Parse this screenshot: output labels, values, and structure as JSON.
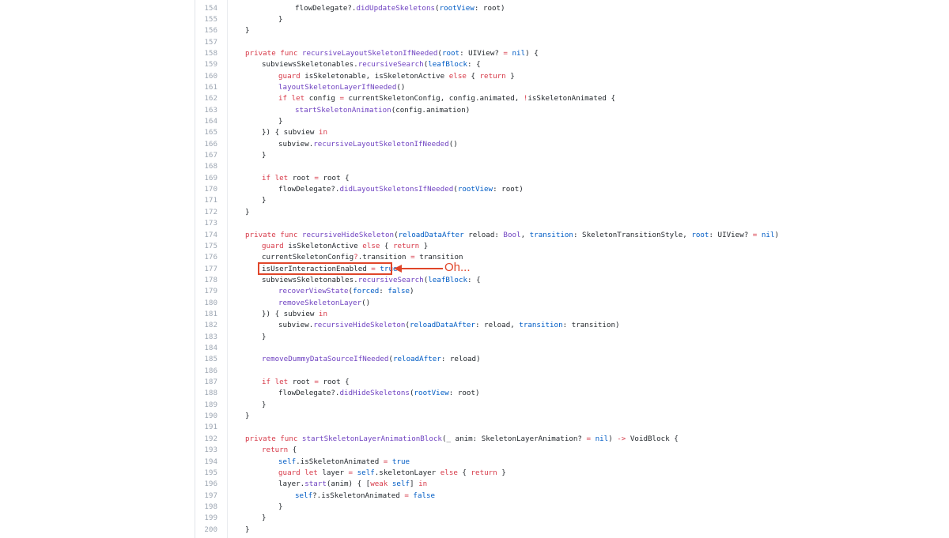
{
  "annotation": {
    "text": "Oh..."
  },
  "lines": [
    {
      "n": "154",
      "indent": 4,
      "tokens": [
        [
          "flowDelegate?.",
          ""
        ],
        [
          "didUpdateSkeletons",
          "f"
        ],
        [
          "(",
          ""
        ],
        [
          "rootView",
          "p"
        ],
        [
          ": root)",
          ""
        ]
      ]
    },
    {
      "n": "155",
      "indent": 3,
      "tokens": [
        [
          "}",
          ""
        ]
      ]
    },
    {
      "n": "156",
      "indent": 1,
      "tokens": [
        [
          "}",
          ""
        ]
      ]
    },
    {
      "n": "157",
      "indent": 0,
      "tokens": []
    },
    {
      "n": "158",
      "indent": 1,
      "tokens": [
        [
          "private func ",
          "k"
        ],
        [
          "recursiveLayoutSkeletonIfNeeded",
          "f"
        ],
        [
          "(",
          ""
        ],
        [
          "root",
          "p"
        ],
        [
          ": UIView? ",
          ""
        ],
        [
          "=",
          "k"
        ],
        [
          " ",
          ""
        ],
        [
          "nil",
          "p"
        ],
        [
          ") {",
          ""
        ]
      ]
    },
    {
      "n": "159",
      "indent": 2,
      "tokens": [
        [
          "subviewsSkeletonables.",
          ""
        ],
        [
          "recursiveSearch",
          "f"
        ],
        [
          "(",
          ""
        ],
        [
          "leafBlock",
          "p"
        ],
        [
          ": {",
          ""
        ]
      ]
    },
    {
      "n": "160",
      "indent": 3,
      "tokens": [
        [
          "guard",
          "k"
        ],
        [
          " isSkeletonable, isSkeletonActive ",
          ""
        ],
        [
          "else",
          "k"
        ],
        [
          " { ",
          ""
        ],
        [
          "return",
          "k"
        ],
        [
          " }",
          ""
        ]
      ]
    },
    {
      "n": "161",
      "indent": 3,
      "tokens": [
        [
          "layoutSkeletonLayerIfNeeded",
          "f"
        ],
        [
          "()",
          ""
        ]
      ]
    },
    {
      "n": "162",
      "indent": 3,
      "tokens": [
        [
          "if let",
          "k"
        ],
        [
          " config ",
          ""
        ],
        [
          "=",
          "k"
        ],
        [
          " currentSkeletonConfig, config.animated, ",
          ""
        ],
        [
          "!",
          "k"
        ],
        [
          "isSkeletonAnimated {",
          ""
        ]
      ]
    },
    {
      "n": "163",
      "indent": 4,
      "tokens": [
        [
          "startSkeletonAnimation",
          "f"
        ],
        [
          "(config.animation)",
          ""
        ]
      ]
    },
    {
      "n": "164",
      "indent": 3,
      "tokens": [
        [
          "}",
          ""
        ]
      ]
    },
    {
      "n": "165",
      "indent": 2,
      "tokens": [
        [
          "}) { subview ",
          ""
        ],
        [
          "in",
          "k"
        ]
      ]
    },
    {
      "n": "166",
      "indent": 3,
      "tokens": [
        [
          "subview.",
          ""
        ],
        [
          "recursiveLayoutSkeletonIfNeeded",
          "f"
        ],
        [
          "()",
          ""
        ]
      ]
    },
    {
      "n": "167",
      "indent": 2,
      "tokens": [
        [
          "}",
          ""
        ]
      ]
    },
    {
      "n": "168",
      "indent": 0,
      "tokens": []
    },
    {
      "n": "169",
      "indent": 2,
      "tokens": [
        [
          "if let",
          "k"
        ],
        [
          " root ",
          ""
        ],
        [
          "=",
          "k"
        ],
        [
          " root {",
          ""
        ]
      ]
    },
    {
      "n": "170",
      "indent": 3,
      "tokens": [
        [
          "flowDelegate?.",
          ""
        ],
        [
          "didLayoutSkeletonsIfNeeded",
          "f"
        ],
        [
          "(",
          ""
        ],
        [
          "rootView",
          "p"
        ],
        [
          ": root)",
          ""
        ]
      ]
    },
    {
      "n": "171",
      "indent": 2,
      "tokens": [
        [
          "}",
          ""
        ]
      ]
    },
    {
      "n": "172",
      "indent": 1,
      "tokens": [
        [
          "}",
          ""
        ]
      ]
    },
    {
      "n": "173",
      "indent": 0,
      "tokens": []
    },
    {
      "n": "174",
      "indent": 1,
      "tokens": [
        [
          "private func ",
          "k"
        ],
        [
          "recursiveHideSkeleton",
          "f"
        ],
        [
          "(",
          ""
        ],
        [
          "reloadDataAfter",
          "p"
        ],
        [
          " reload: ",
          ""
        ],
        [
          "Bool",
          "f"
        ],
        [
          ", ",
          ""
        ],
        [
          "transition",
          "p"
        ],
        [
          ": SkeletonTransitionStyle, ",
          ""
        ],
        [
          "root",
          "p"
        ],
        [
          ": UIView? ",
          ""
        ],
        [
          "=",
          "k"
        ],
        [
          " ",
          ""
        ],
        [
          "nil",
          "p"
        ],
        [
          ")",
          ""
        ]
      ]
    },
    {
      "n": "175",
      "indent": 2,
      "tokens": [
        [
          "guard",
          "k"
        ],
        [
          " isSkeletonActive ",
          ""
        ],
        [
          "else",
          "k"
        ],
        [
          " { ",
          ""
        ],
        [
          "return",
          "k"
        ],
        [
          " }",
          ""
        ]
      ]
    },
    {
      "n": "176",
      "indent": 2,
      "tokens": [
        [
          "currentSkeletonConfig",
          ""
        ],
        [
          "?",
          "k"
        ],
        [
          ".transition ",
          ""
        ],
        [
          "=",
          "k"
        ],
        [
          " transition",
          ""
        ]
      ]
    },
    {
      "n": "177",
      "indent": 2,
      "tokens": [
        [
          "isUserInteractionEnabled ",
          ""
        ],
        [
          "=",
          "k"
        ],
        [
          " ",
          ""
        ],
        [
          "true",
          "p"
        ]
      ]
    },
    {
      "n": "178",
      "indent": 2,
      "tokens": [
        [
          "subviewsSkeletonables.",
          ""
        ],
        [
          "recursiveSearch",
          "f"
        ],
        [
          "(",
          ""
        ],
        [
          "leafBlock",
          "p"
        ],
        [
          ": {",
          ""
        ]
      ]
    },
    {
      "n": "179",
      "indent": 3,
      "tokens": [
        [
          "recoverViewState",
          "f"
        ],
        [
          "(",
          ""
        ],
        [
          "forced",
          "p"
        ],
        [
          ": ",
          ""
        ],
        [
          "false",
          "p"
        ],
        [
          ")",
          ""
        ]
      ]
    },
    {
      "n": "180",
      "indent": 3,
      "tokens": [
        [
          "removeSkeletonLayer",
          "f"
        ],
        [
          "()",
          ""
        ]
      ]
    },
    {
      "n": "181",
      "indent": 2,
      "tokens": [
        [
          "}) { subview ",
          ""
        ],
        [
          "in",
          "k"
        ]
      ]
    },
    {
      "n": "182",
      "indent": 3,
      "tokens": [
        [
          "subview.",
          ""
        ],
        [
          "recursiveHideSkeleton",
          "f"
        ],
        [
          "(",
          ""
        ],
        [
          "reloadDataAfter",
          "p"
        ],
        [
          ": reload, ",
          ""
        ],
        [
          "transition",
          "p"
        ],
        [
          ": transition)",
          ""
        ]
      ]
    },
    {
      "n": "183",
      "indent": 2,
      "tokens": [
        [
          "}",
          ""
        ]
      ]
    },
    {
      "n": "184",
      "indent": 0,
      "tokens": []
    },
    {
      "n": "185",
      "indent": 2,
      "tokens": [
        [
          "removeDummyDataSourceIfNeeded",
          "f"
        ],
        [
          "(",
          ""
        ],
        [
          "reloadAfter",
          "p"
        ],
        [
          ": reload)",
          ""
        ]
      ]
    },
    {
      "n": "186",
      "indent": 0,
      "tokens": []
    },
    {
      "n": "187",
      "indent": 2,
      "tokens": [
        [
          "if let",
          "k"
        ],
        [
          " root ",
          ""
        ],
        [
          "=",
          "k"
        ],
        [
          " root {",
          ""
        ]
      ]
    },
    {
      "n": "188",
      "indent": 3,
      "tokens": [
        [
          "flowDelegate?.",
          ""
        ],
        [
          "didHideSkeletons",
          "f"
        ],
        [
          "(",
          ""
        ],
        [
          "rootView",
          "p"
        ],
        [
          ": root)",
          ""
        ]
      ]
    },
    {
      "n": "189",
      "indent": 2,
      "tokens": [
        [
          "}",
          ""
        ]
      ]
    },
    {
      "n": "190",
      "indent": 1,
      "tokens": [
        [
          "}",
          ""
        ]
      ]
    },
    {
      "n": "191",
      "indent": 0,
      "tokens": []
    },
    {
      "n": "192",
      "indent": 1,
      "tokens": [
        [
          "private func ",
          "k"
        ],
        [
          "startSkeletonLayerAnimationBlock",
          "f"
        ],
        [
          "(_ anim: SkeletonLayerAnimation? ",
          ""
        ],
        [
          "=",
          "k"
        ],
        [
          " ",
          ""
        ],
        [
          "nil",
          "p"
        ],
        [
          ") ",
          ""
        ],
        [
          "->",
          "k"
        ],
        [
          " VoidBlock {",
          ""
        ]
      ]
    },
    {
      "n": "193",
      "indent": 2,
      "tokens": [
        [
          "return",
          "k"
        ],
        [
          " {",
          ""
        ]
      ]
    },
    {
      "n": "194",
      "indent": 3,
      "tokens": [
        [
          "self",
          "p"
        ],
        [
          ".isSkeletonAnimated ",
          ""
        ],
        [
          "=",
          "k"
        ],
        [
          " ",
          ""
        ],
        [
          "true",
          "p"
        ]
      ]
    },
    {
      "n": "195",
      "indent": 3,
      "tokens": [
        [
          "guard let",
          "k"
        ],
        [
          " layer ",
          ""
        ],
        [
          "=",
          "k"
        ],
        [
          " ",
          ""
        ],
        [
          "self",
          "p"
        ],
        [
          ".skeletonLayer ",
          ""
        ],
        [
          "else",
          "k"
        ],
        [
          " { ",
          ""
        ],
        [
          "return",
          "k"
        ],
        [
          " }",
          ""
        ]
      ]
    },
    {
      "n": "196",
      "indent": 3,
      "tokens": [
        [
          "layer.",
          ""
        ],
        [
          "start",
          "f"
        ],
        [
          "(anim) { [",
          ""
        ],
        [
          "weak",
          "k"
        ],
        [
          " ",
          ""
        ],
        [
          "self",
          "p"
        ],
        [
          "] ",
          ""
        ],
        [
          "in",
          "k"
        ]
      ]
    },
    {
      "n": "197",
      "indent": 4,
      "tokens": [
        [
          "self",
          "p"
        ],
        [
          "?.isSkeletonAnimated ",
          ""
        ],
        [
          "=",
          "k"
        ],
        [
          " ",
          ""
        ],
        [
          "false",
          "p"
        ]
      ]
    },
    {
      "n": "198",
      "indent": 3,
      "tokens": [
        [
          "}",
          ""
        ]
      ]
    },
    {
      "n": "199",
      "indent": 2,
      "tokens": [
        [
          "}",
          ""
        ]
      ]
    },
    {
      "n": "200",
      "indent": 1,
      "tokens": [
        [
          "}",
          ""
        ]
      ]
    }
  ]
}
